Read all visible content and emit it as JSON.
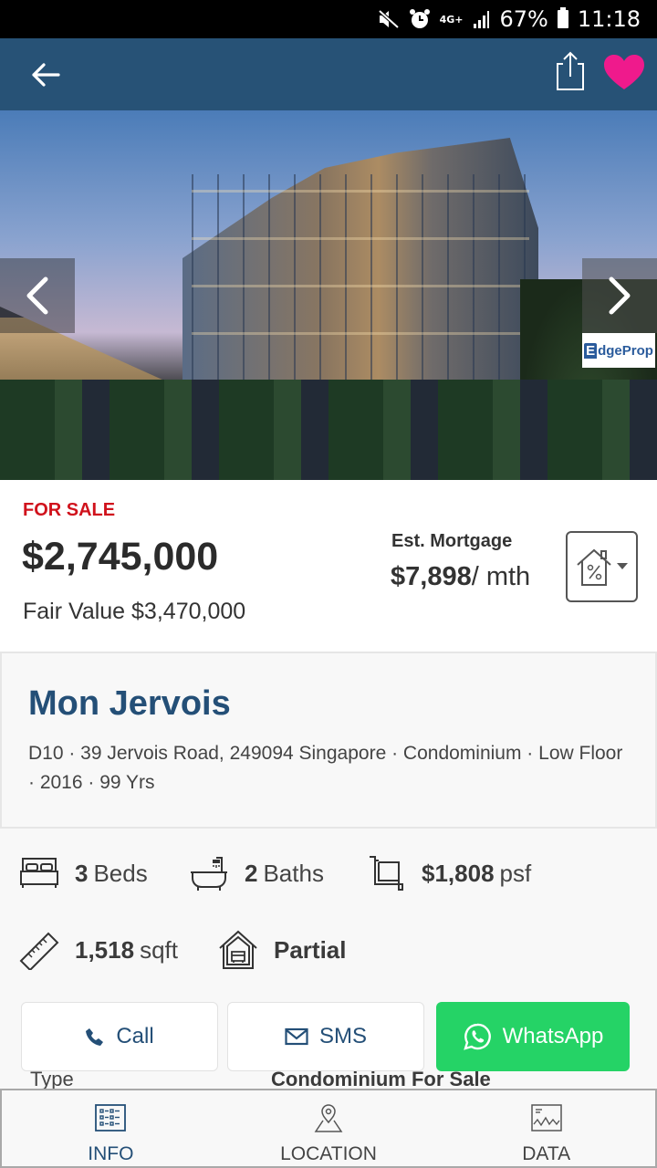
{
  "status_bar": {
    "network": "4G+",
    "battery": "67%",
    "time": "11:18",
    "icons": [
      "mute-icon",
      "alarm-icon",
      "network-icon",
      "signal-icon",
      "battery-icon"
    ]
  },
  "app_bar": {
    "back_icon": "arrow-left-icon",
    "share_icon": "share-icon",
    "favorite_icon": "heart-icon",
    "favorite_color": "#ef1a8c",
    "background": "#275276"
  },
  "gallery": {
    "watermark_e": "E",
    "watermark_text": "dgeProp",
    "prev_icon": "chevron-left-icon",
    "next_icon": "chevron-right-icon"
  },
  "listing": {
    "status": "FOR SALE",
    "status_color": "#d0121c",
    "price": "$2,745,000",
    "fair_value": "Fair Value $3,470,000",
    "mortgage_label": "Est. Mortgage",
    "mortgage_amount": "$7,898",
    "mortgage_unit": "/ mth",
    "mortgage_icon": "mortgage-calculator-icon"
  },
  "property": {
    "name": "Mon Jervois",
    "address": "D10 · 39 Jervois Road, 249094 Singapore · Condominium · Low Floor · 2016 · 99 Yrs"
  },
  "features": {
    "beds_count": "3",
    "beds_label": "Beds",
    "baths_count": "2",
    "baths_label": "Baths",
    "psf_value": "$1,808",
    "psf_label": "psf",
    "size_value": "1,518",
    "size_label": "sqft",
    "furnishing": "Partial"
  },
  "actions": {
    "call": "Call",
    "sms": "SMS",
    "whatsapp": "WhatsApp",
    "whatsapp_color": "#25d366"
  },
  "details": {
    "type_label": "Type",
    "type_value": "Condominium For Sale"
  },
  "tabs": [
    {
      "label": "INFO",
      "active": true
    },
    {
      "label": "LOCATION",
      "active": false
    },
    {
      "label": "DATA",
      "active": false
    }
  ]
}
